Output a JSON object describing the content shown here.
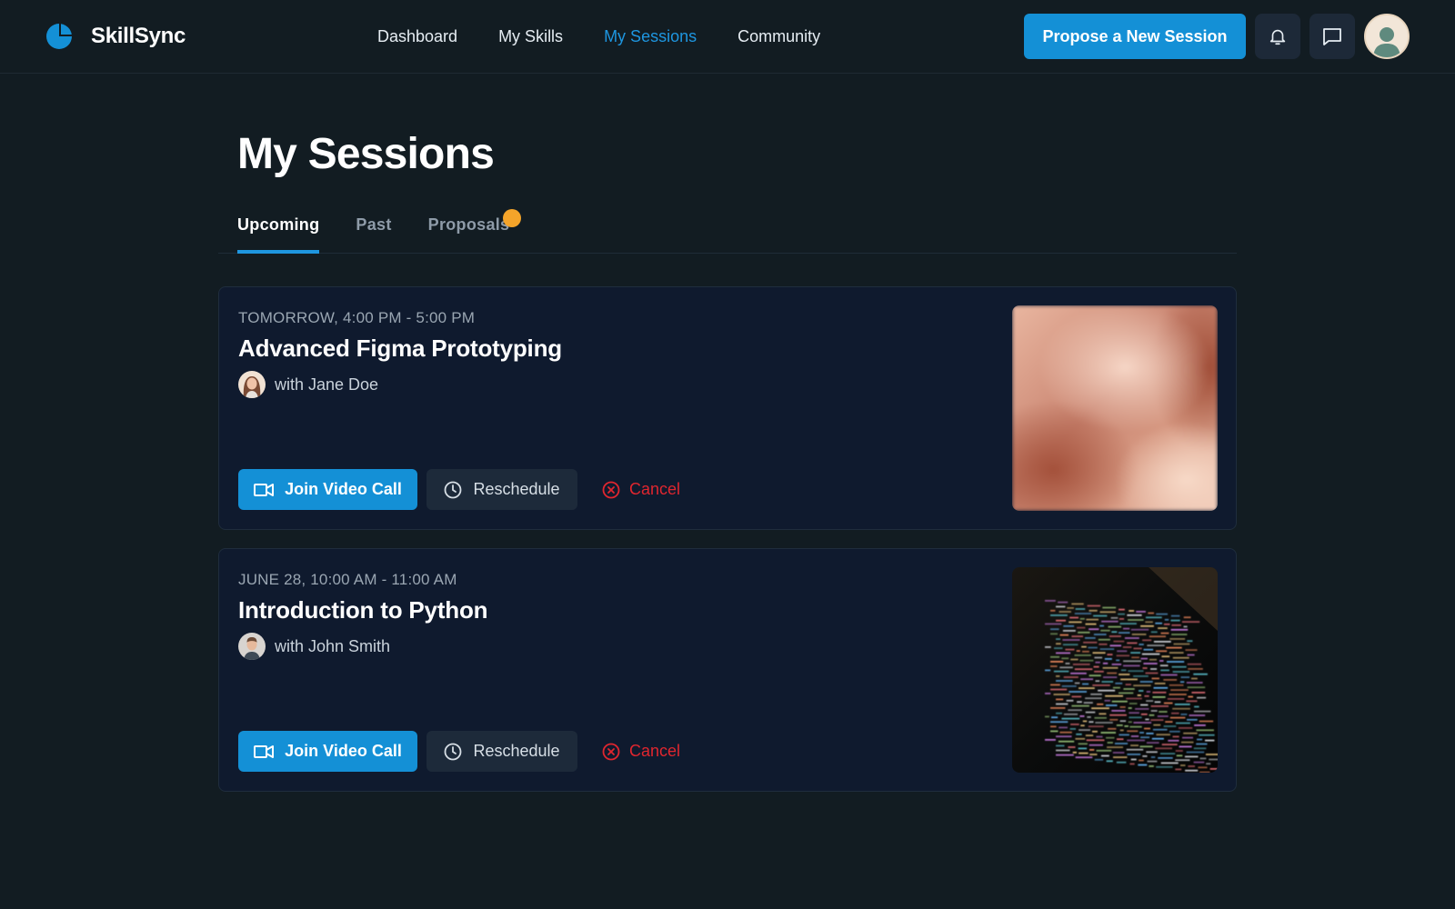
{
  "brand": {
    "name": "SkillSync",
    "logo_icon": "skillsync-logo-icon"
  },
  "nav": {
    "items": [
      {
        "label": "Dashboard",
        "active": false
      },
      {
        "label": "My Skills",
        "active": false
      },
      {
        "label": "My Sessions",
        "active": true
      },
      {
        "label": "Community",
        "active": false
      }
    ]
  },
  "topbar": {
    "propose_label": "Propose a New Session",
    "notification_icon": "bell-icon",
    "messages_icon": "chat-icon",
    "avatar_icon": "user-avatar"
  },
  "page": {
    "title": "My Sessions"
  },
  "tabs": [
    {
      "label": "Upcoming",
      "active": true
    },
    {
      "label": "Past",
      "active": false
    },
    {
      "label": "Proposals",
      "active": false,
      "has_notification_dot": true
    }
  ],
  "sessions": [
    {
      "time": "TOMORROW, 4:00 PM - 5:00 PM",
      "title": "Advanced Figma Prototyping",
      "host": "with Jane Doe",
      "thumbnail": "blurred-portrait-image",
      "join_label": "Join Video Call",
      "reschedule_label": "Reschedule",
      "cancel_label": "Cancel"
    },
    {
      "time": "JUNE 28, 10:00 AM - 11:00 AM",
      "title": "Introduction to Python",
      "host": "with John Smith",
      "thumbnail": "code-screen-image",
      "join_label": "Join Video Call",
      "reschedule_label": "Reschedule",
      "cancel_label": "Cancel"
    }
  ],
  "colors": {
    "background": "#121c22",
    "accent": "#1490d6",
    "card": "#0f1a2e",
    "danger": "#e0262f",
    "notification_dot": "#f4a42a"
  }
}
